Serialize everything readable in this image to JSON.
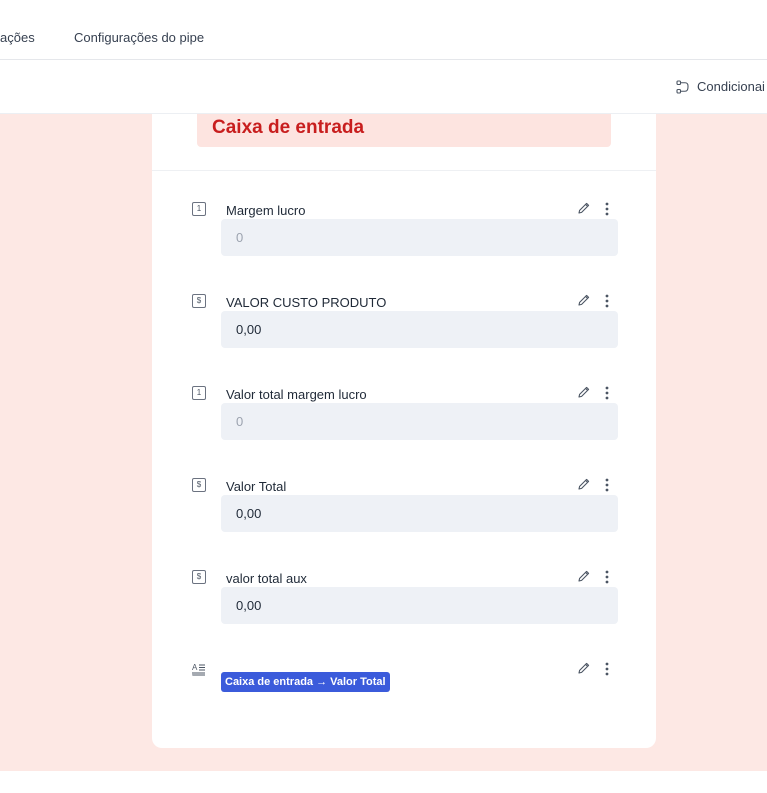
{
  "top_nav": {
    "tabs": [
      {
        "label": "ações"
      },
      {
        "label": "Configurações do pipe"
      }
    ]
  },
  "toolbar": {
    "conditionals_label": "Condicionai",
    "conditionals_icon": "branch-icon"
  },
  "colors": {
    "canvas_bg": "#fde8e4",
    "phase_header_bg": "#fde4e0",
    "phase_title": "#c81e1e",
    "field_bg": "#eef1f6",
    "tag_bg": "#3b5bdb"
  },
  "phase": {
    "title": "Caixa de entrada"
  },
  "fields": [
    {
      "type_icon": "1",
      "label": "Margem lucro",
      "value": "0",
      "placeholder": true
    },
    {
      "type_icon": "$",
      "label": "VALOR CUSTO PRODUTO",
      "value": "0,00",
      "placeholder": false
    },
    {
      "type_icon": "1",
      "label": "Valor total margem lucro",
      "value": "0",
      "placeholder": true
    },
    {
      "type_icon": "$",
      "label": "Valor Total",
      "value": "0,00",
      "placeholder": false
    },
    {
      "type_icon": "$",
      "label": "valor total aux",
      "value": "0,00",
      "placeholder": false
    }
  ],
  "statement_field": {
    "type_icon": "text-format-icon",
    "tag_label": "Caixa de entrada → Valor Total"
  }
}
